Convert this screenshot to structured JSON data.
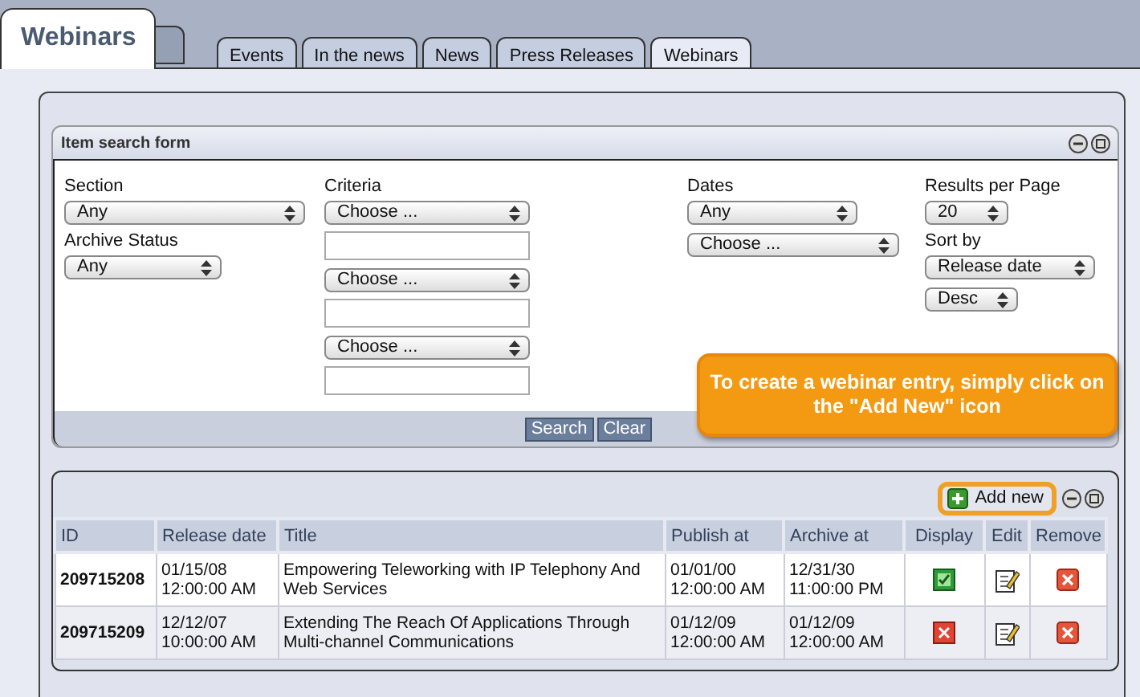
{
  "main_tab": {
    "label": "Webinars"
  },
  "tabs": [
    {
      "label": "Events",
      "selected": false
    },
    {
      "label": "In the news",
      "selected": false
    },
    {
      "label": "News",
      "selected": false
    },
    {
      "label": "Press Releases",
      "selected": false
    },
    {
      "label": "Webinars",
      "selected": true
    }
  ],
  "search_form": {
    "title": "Item search form",
    "section": {
      "label": "Section",
      "value": "Any"
    },
    "archive_status": {
      "label": "Archive Status",
      "value": "Any"
    },
    "criteria": {
      "label": "Criteria",
      "selects": [
        "Choose ...",
        "Choose ...",
        "Choose ..."
      ]
    },
    "dates": {
      "label": "Dates",
      "selects": [
        "Any",
        "Choose ..."
      ]
    },
    "results_per_page": {
      "label": "Results per Page",
      "value": "20"
    },
    "sort_by": {
      "label": "Sort by",
      "selects": [
        "Release date",
        "Desc"
      ]
    },
    "buttons": [
      "Search",
      "Clear"
    ]
  },
  "callout": {
    "text": "To create a webinar entry, simply click on the \"Add New\" icon"
  },
  "results": {
    "add_new": "Add new",
    "columns": [
      "ID",
      "Release date",
      "Title",
      "Publish at",
      "Archive at",
      "Display",
      "Edit",
      "Remove"
    ],
    "rows": [
      {
        "id": "209715208",
        "release_date": "01/15/08\n12:00:00 AM",
        "title": "Empowering Teleworking with IP Telephony And Web Services",
        "publish_at": "01/01/00\n12:00:00 AM",
        "archive_at": "12/31/30\n11:00:00 PM",
        "displayed": true
      },
      {
        "id": "209715209",
        "release_date": "12/12/07\n10:00:00 AM",
        "title": "Extending The Reach Of Applications Through Multi-channel Communications",
        "publish_at": "01/12/09\n12:00:00 AM",
        "archive_at": "01/12/09\n12:00:00 AM",
        "displayed": false
      }
    ]
  }
}
